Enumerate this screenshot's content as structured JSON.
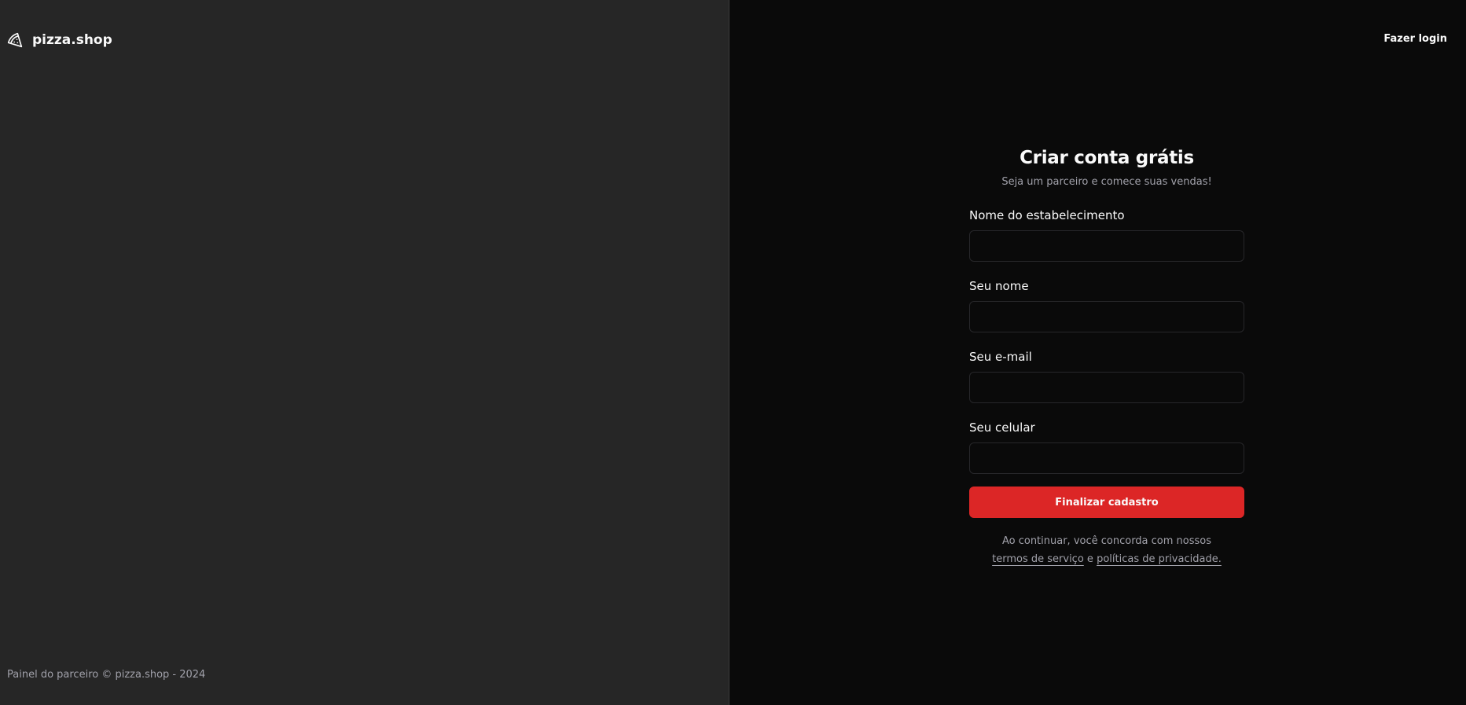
{
  "brand": {
    "name": "pizza.shop",
    "icon": "pizza-icon"
  },
  "footer": {
    "text": "Painel do parceiro © pizza.shop - 2024"
  },
  "header": {
    "login_link": "Fazer login"
  },
  "form": {
    "title": "Criar conta grátis",
    "subtitle": "Seja um parceiro e comece suas vendas!",
    "fields": [
      {
        "label": "Nome do estabelecimento",
        "value": "",
        "placeholder": ""
      },
      {
        "label": "Seu nome",
        "value": "",
        "placeholder": ""
      },
      {
        "label": "Seu e-mail",
        "value": "",
        "placeholder": ""
      },
      {
        "label": "Seu celular",
        "value": "",
        "placeholder": ""
      }
    ],
    "submit_label": "Finalizar cadastro",
    "terms": {
      "prefix": "Ao continuar, você concorda com nossos",
      "terms_link": "termos de serviço",
      "connector": "e",
      "privacy_link": "políticas de privacidade."
    }
  },
  "colors": {
    "left_panel_bg": "#262626",
    "right_panel_bg": "#0a0a0a",
    "accent": "#dc2626",
    "muted_text": "#a1a1aa"
  }
}
